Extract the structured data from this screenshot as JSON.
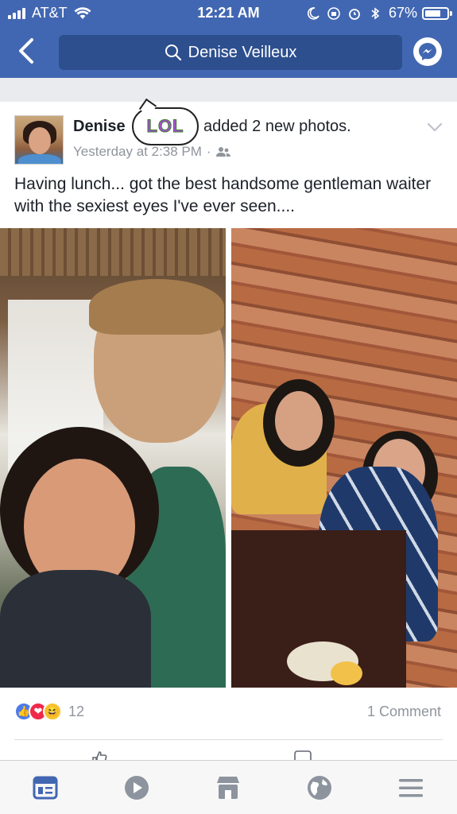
{
  "status_bar": {
    "carrier": "AT&T",
    "time": "12:21 AM",
    "battery_pct": "67%"
  },
  "header": {
    "search_text": "Denise Veilleux",
    "back_icon": "chevron-left-icon",
    "messenger_icon": "messenger-icon"
  },
  "post": {
    "author": "Denise",
    "sticker_text": "LOL",
    "action": "added 2 new photos.",
    "time": "Yesterday at 2:38 PM",
    "separator": "·",
    "text": "Having lunch... got the best handsome gentleman waiter with the sexiest eyes I've ever seen....",
    "photo_count": 2
  },
  "reactions": {
    "count": "12",
    "comments": "1 Comment"
  },
  "colors": {
    "brand": "#4267b2",
    "search_bg": "#2d4f8e",
    "meta_text": "#90949c",
    "tab_active": "#4267b2"
  },
  "tabbar": {
    "tabs": [
      {
        "name": "news-feed-icon",
        "active": true
      },
      {
        "name": "video-icon",
        "active": false
      },
      {
        "name": "marketplace-icon",
        "active": false
      },
      {
        "name": "globe-icon",
        "active": false
      },
      {
        "name": "menu-icon",
        "active": false
      }
    ]
  }
}
